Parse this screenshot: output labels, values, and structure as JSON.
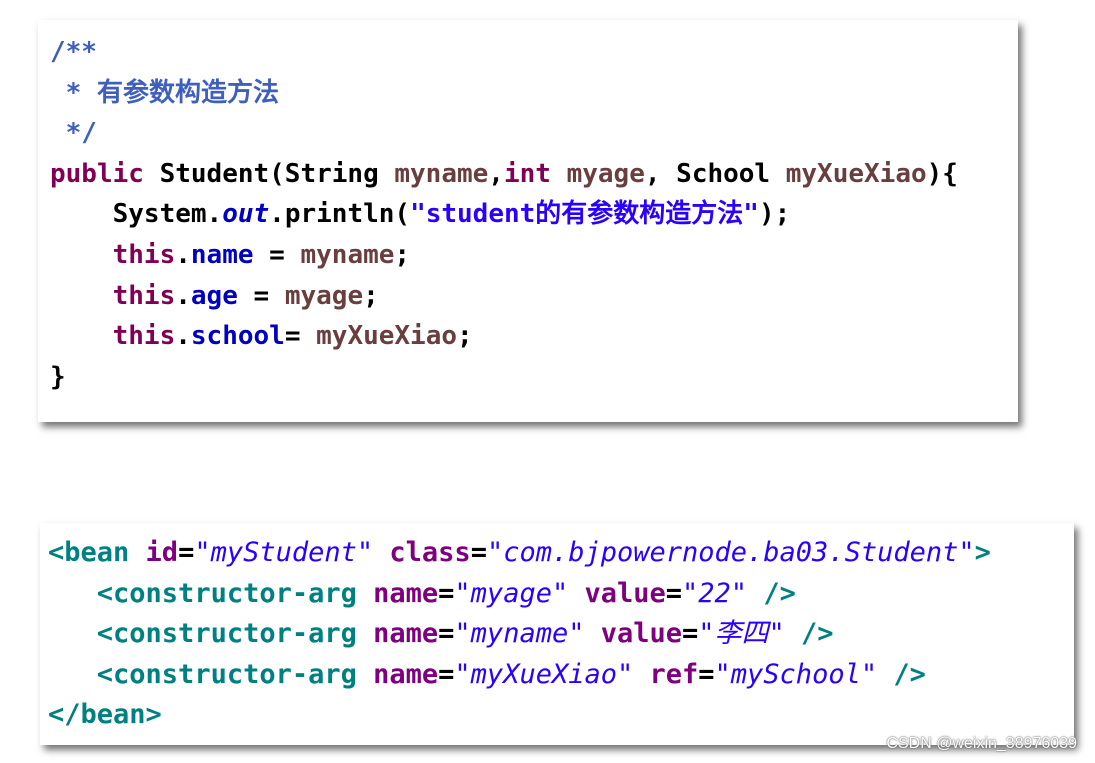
{
  "java": {
    "l1": "/**",
    "l2": " * 有参数构造方法",
    "l3": " */",
    "l4": {
      "kw": "public",
      "cls": " Student(String ",
      "p1": "myname",
      "t2": ",",
      "kw2": "int",
      "sp": " ",
      "p2": "myage",
      "t3": ", School ",
      "p3": "myXueXiao",
      "t4": "){"
    },
    "l5": {
      "indent": "    ",
      "a": "System.",
      "out": "out",
      "b": ".println(",
      "str": "\"student的有参数构造方法\"",
      "c": ");"
    },
    "l6": {
      "indent": "    ",
      "kw": "this",
      "dot": ".",
      "f": "name",
      "eq": " = ",
      "v": "myname",
      "end": ";"
    },
    "l7": {
      "indent": "    ",
      "kw": "this",
      "dot": ".",
      "f": "age",
      "eq": " = ",
      "v": "myage",
      "end": ";"
    },
    "l8": {
      "indent": "    ",
      "kw": "this",
      "dot": ".",
      "f": "school",
      "eq": "= ",
      "v": "myXueXiao",
      "end": ";"
    },
    "l9": "}"
  },
  "xml": {
    "l1": {
      "open": "<bean",
      "a1": " id",
      "e1": "=",
      "v1": "\"myStudent\"",
      "a2": " class",
      "e2": "=",
      "v2": "\"com.bjpowernode.ba03.Student\"",
      "close": ">"
    },
    "l2": {
      "indent": "   ",
      "open": "<constructor-arg",
      "a1": " name",
      "e1": "=",
      "v1": "\"myage\"",
      "a2": " value",
      "e2": "=",
      "v2": "\"22\"",
      "close": " />"
    },
    "l3": {
      "indent": "   ",
      "open": "<constructor-arg",
      "a1": " name",
      "e1": "=",
      "v1": "\"myname\"",
      "a2": " value",
      "e2": "=",
      "v2": "\"李四\"",
      "close": " />"
    },
    "l4": {
      "indent": "   ",
      "open": "<constructor-arg",
      "a1": " name",
      "e1": "=",
      "v1": "\"myXueXiao\"",
      "a2": " ref",
      "e2": "=",
      "v2": "\"mySchool\"",
      "close": " />"
    },
    "l5": "</bean>"
  },
  "watermark": "CSDN @weixin_38976039"
}
